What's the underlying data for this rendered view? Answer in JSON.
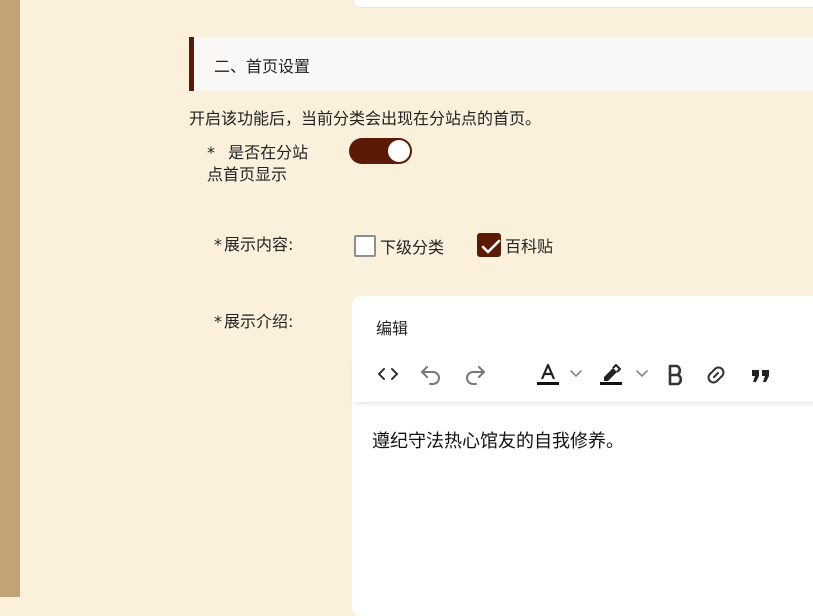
{
  "section": {
    "title": "二、首页设置"
  },
  "description": "开启该功能后，当前分类会出现在分站点的首页。",
  "fields": {
    "homepage_display": {
      "required_mark": "*",
      "label_line1": "是否在分站",
      "label_line2": "点首页显示",
      "value": true
    },
    "display_content": {
      "required_mark": "*",
      "label": "展示内容:",
      "options": [
        {
          "label": "下级分类",
          "checked": false
        },
        {
          "label": "百科贴",
          "checked": true
        }
      ]
    },
    "display_intro": {
      "required_mark": "*",
      "label": "展示介绍:"
    }
  },
  "editor": {
    "title": "编辑",
    "toolbar": [
      "code-icon",
      "undo-icon",
      "redo-icon",
      "font-color-icon",
      "dropdown-icon",
      "highlight-icon",
      "dropdown-icon",
      "bold-icon",
      "link-icon",
      "quote-icon"
    ],
    "content": "遵纪守法热心馆友的自我修养。"
  },
  "colors": {
    "accent": "#5a1a05",
    "background": "#faf0dc",
    "sidebar": "#c3a277"
  }
}
